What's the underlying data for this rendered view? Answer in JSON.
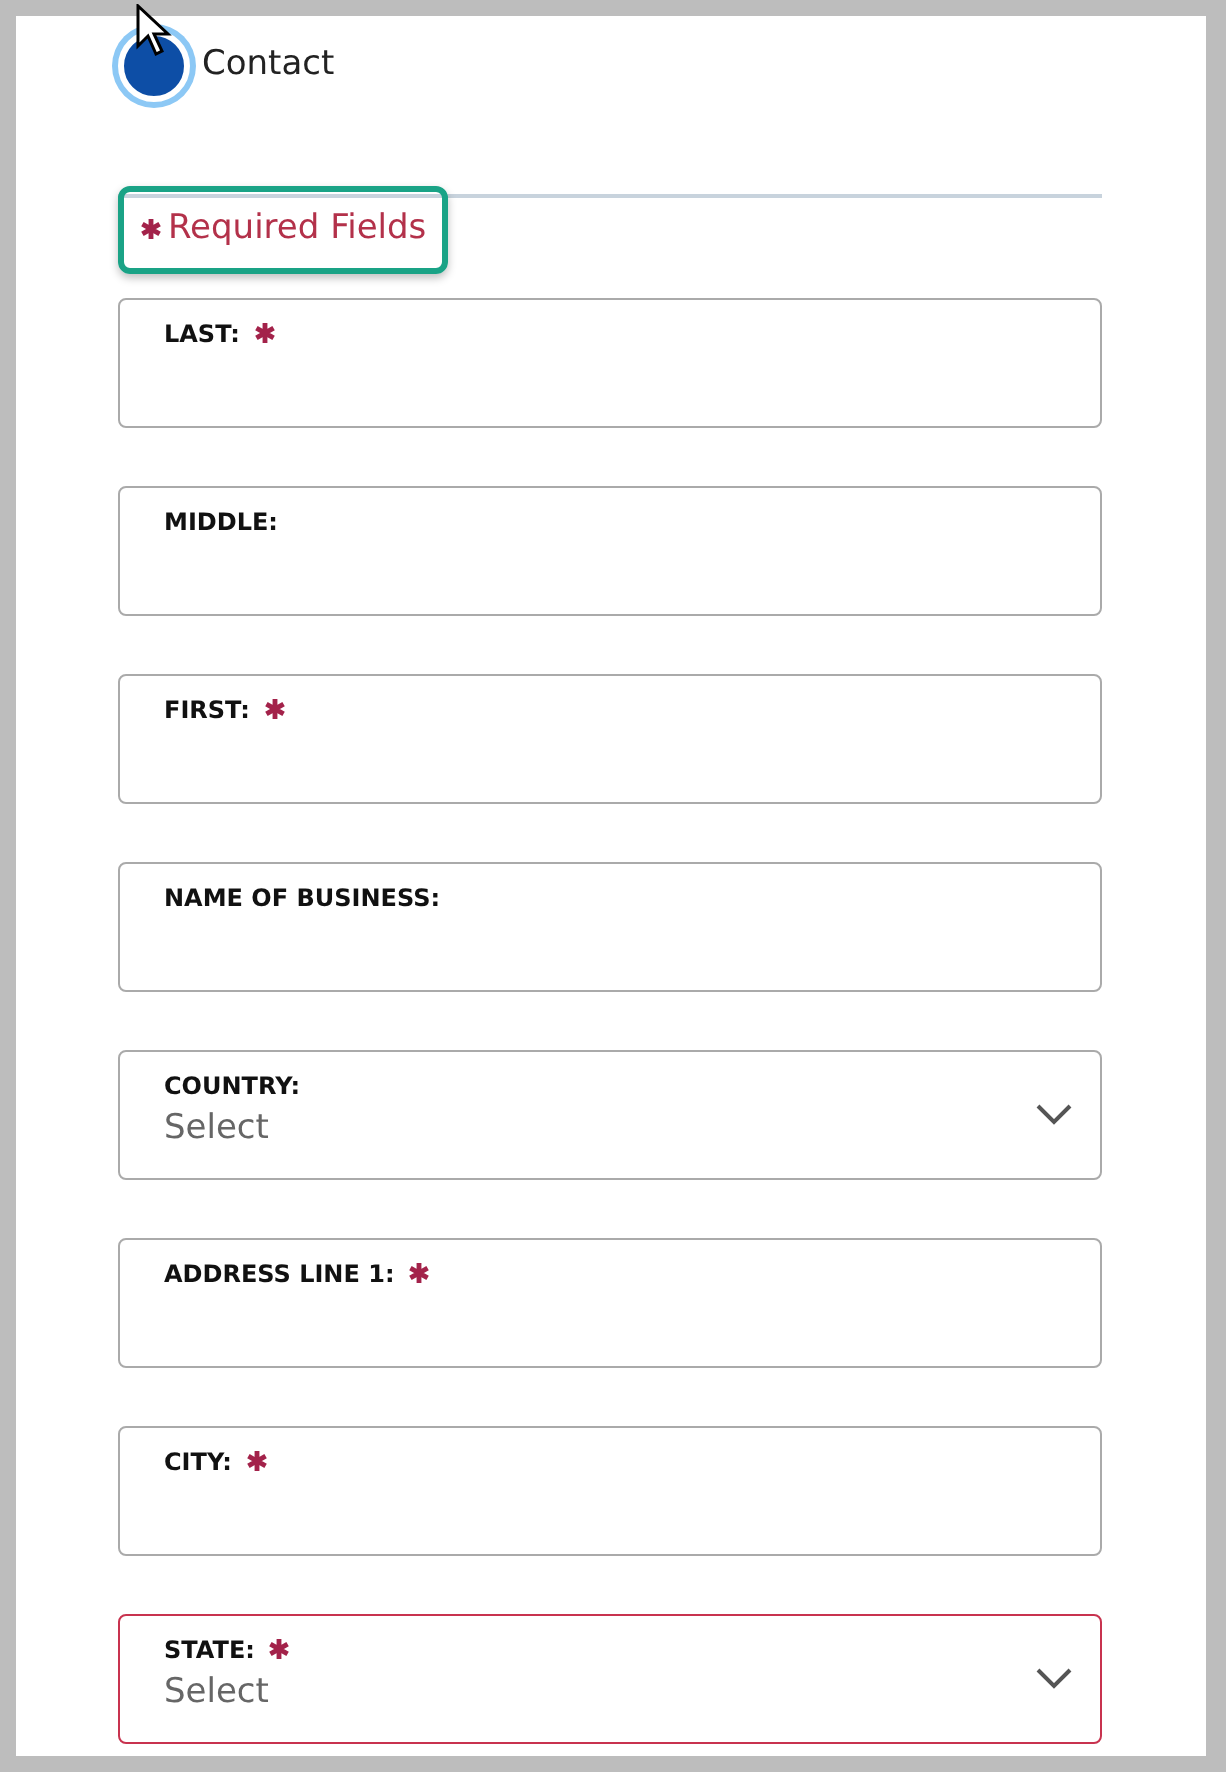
{
  "step": {
    "label": "Contact",
    "active": true
  },
  "legend": {
    "text": "Required Fields",
    "focused": true
  },
  "fields": [
    {
      "kind": "text",
      "label": "LAST:",
      "required": true,
      "invalid": false
    },
    {
      "kind": "text",
      "label": "MIDDLE:",
      "required": false,
      "invalid": false
    },
    {
      "kind": "text",
      "label": "FIRST:",
      "required": true,
      "invalid": false
    },
    {
      "kind": "text",
      "label": "NAME OF BUSINESS:",
      "required": false,
      "invalid": false
    },
    {
      "kind": "select",
      "label": "COUNTRY:",
      "required": false,
      "invalid": false,
      "placeholder": "Select"
    },
    {
      "kind": "text",
      "label": "ADDRESS LINE 1:",
      "required": true,
      "invalid": false
    },
    {
      "kind": "text",
      "label": "CITY:",
      "required": true,
      "invalid": false
    },
    {
      "kind": "select",
      "label": "STATE:",
      "required": true,
      "invalid": true,
      "placeholder": "Select"
    }
  ]
}
